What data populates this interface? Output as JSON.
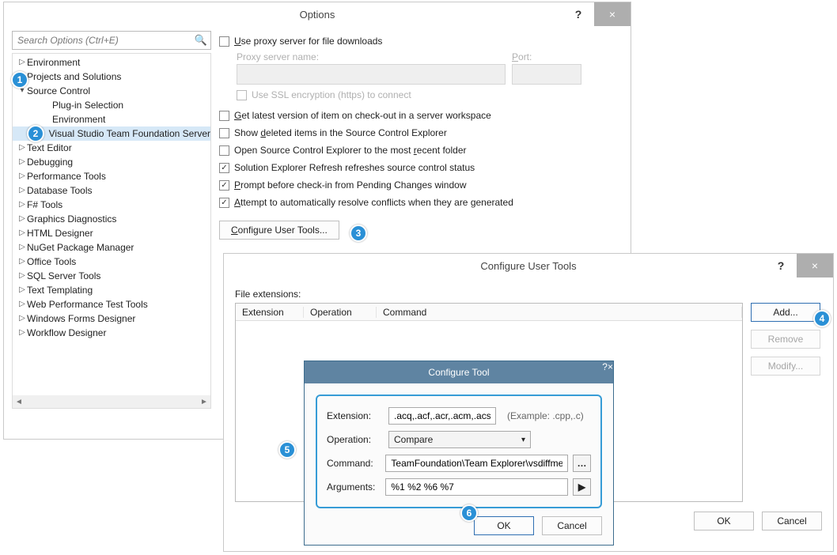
{
  "options_window": {
    "title": "Options",
    "search_placeholder": "Search Options (Ctrl+E)",
    "tree": [
      {
        "label": "Environment",
        "kind": "parent"
      },
      {
        "label": "Projects and Solutions",
        "kind": "parent"
      },
      {
        "label": "Source Control",
        "kind": "parent-open"
      },
      {
        "label": "Plug-in Selection",
        "kind": "child"
      },
      {
        "label": "Environment",
        "kind": "child"
      },
      {
        "label": "Visual Studio Team Foundation Server",
        "kind": "child-sel"
      },
      {
        "label": "Text Editor",
        "kind": "parent"
      },
      {
        "label": "Debugging",
        "kind": "parent"
      },
      {
        "label": "Performance Tools",
        "kind": "parent"
      },
      {
        "label": "Database Tools",
        "kind": "parent"
      },
      {
        "label": "F# Tools",
        "kind": "parent"
      },
      {
        "label": "Graphics Diagnostics",
        "kind": "parent"
      },
      {
        "label": "HTML Designer",
        "kind": "parent"
      },
      {
        "label": "NuGet Package Manager",
        "kind": "parent"
      },
      {
        "label": "Office Tools",
        "kind": "parent"
      },
      {
        "label": "SQL Server Tools",
        "kind": "parent"
      },
      {
        "label": "Text Templating",
        "kind": "parent"
      },
      {
        "label": "Web Performance Test Tools",
        "kind": "parent"
      },
      {
        "label": "Windows Forms Designer",
        "kind": "parent"
      },
      {
        "label": "Workflow Designer",
        "kind": "parent"
      }
    ],
    "proxy": {
      "use_label_pre": "U",
      "use_label_post": "se proxy server for file downloads",
      "name_label": "Proxy server name:",
      "port_label_pre": "P",
      "port_label_post": "ort:",
      "ssl_label": "Use SSL encryption (https) to connect"
    },
    "checks": {
      "get_latest_pre": "G",
      "get_latest_post": "et latest version of item on check-out in a server workspace",
      "show_deleted_pre": "Show ",
      "show_deleted_u": "d",
      "show_deleted_post": "eleted items in the Source Control Explorer",
      "open_sce_pre": "Open Source Control Explorer to the most ",
      "open_sce_u": "r",
      "open_sce_post": "ecent folder",
      "refresh": "Solution Explorer Refresh refreshes source control status",
      "prompt_pre": "P",
      "prompt_post": "rompt before check-in from Pending Changes window",
      "resolve_pre": "A",
      "resolve_post": "ttempt to automatically resolve conflicts when they are generated"
    },
    "configure_btn_pre": "C",
    "configure_btn_post": "onfigure User Tools..."
  },
  "cut_window": {
    "title": "Configure User Tools",
    "file_ext_label": "File extensions:",
    "headers": {
      "ext": "Extension",
      "op": "Operation",
      "cmd": "Command"
    },
    "buttons": {
      "add": "Add...",
      "remove": "Remove",
      "modify": "Modify..."
    },
    "ok": "OK",
    "cancel": "Cancel"
  },
  "tool_window": {
    "title": "Configure Tool",
    "fields": {
      "extension": "Extension:",
      "operation": "Operation:",
      "command": "Command:",
      "arguments": "Arguments:"
    },
    "values": {
      "extension": ".acq,.acf,.acr,.acm,.acs",
      "operation": "Compare",
      "command": "TeamFoundation\\Team Explorer\\vsdiffmerge.exe",
      "arguments": "%1 %2 %6 %7"
    },
    "example": "(Example: .cpp,.c)",
    "ok": "OK",
    "cancel": "Cancel"
  },
  "badges": {
    "1": "1",
    "2": "2",
    "3": "3",
    "4": "4",
    "5": "5",
    "6": "6"
  }
}
